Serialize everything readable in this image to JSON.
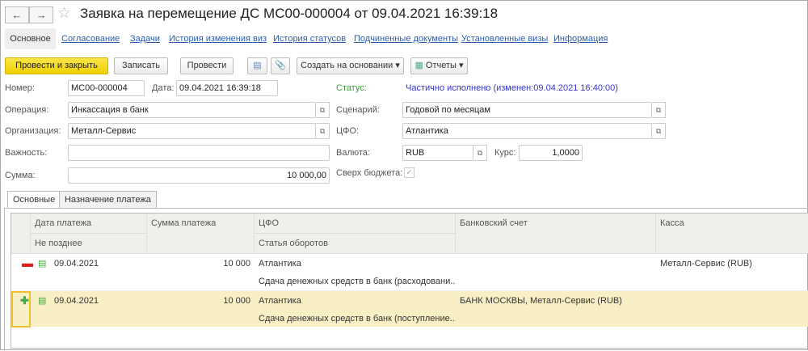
{
  "window": {
    "title": "Заявка на перемещение ДС МС00-000004 от 09.04.2021 16:39:18",
    "back": "←",
    "forward": "→",
    "star": "☆"
  },
  "tabs": [
    "Основное",
    "Согласование",
    "Задачи",
    "История изменения виз",
    "История статусов",
    "Подчиненные документы",
    "Установленные визы",
    "Информация"
  ],
  "toolbar": {
    "post_close": "Провести и закрыть",
    "save": "Записать",
    "post": "Провести",
    "create_based": "Создать на основании",
    "reports": "Отчеты",
    "dropdown": "▾"
  },
  "form": {
    "number_label": "Номер:",
    "number": "МС00-000004",
    "date_label": "Дата:",
    "date": "09.04.2021 16:39:18",
    "operation_label": "Операция:",
    "operation": "Инкассация в банк",
    "org_label": "Организация:",
    "org": "Металл-Сервис",
    "importance_label": "Важность:",
    "importance": "",
    "sum_label": "Сумма:",
    "sum": "10 000,00",
    "status_label": "Статус:",
    "status": "Частично исполнено (изменен:09.04.2021 16:40:00)",
    "scenario_label": "Сценарий:",
    "scenario": "Годовой по месяцам",
    "cfo_label": "ЦФО:",
    "cfo": "Атлантика",
    "currency_label": "Валюта:",
    "currency": "RUB",
    "rate_label": "Курс:",
    "rate": "1,0000",
    "over_budget_label": "Сверх бюджета:",
    "over_budget": true
  },
  "subtabs": [
    "Основные",
    "Назначение платежа"
  ],
  "table": {
    "headers": {
      "date": "Дата платежа",
      "not_later": "Не позднее",
      "sum": "Сумма платежа",
      "cfo": "ЦФО",
      "article": "Статья оборотов",
      "bank": "Банковский счет",
      "cash": "Касса"
    },
    "rows": [
      {
        "sign": "minus",
        "date": "09.04.2021",
        "sum": "10 000",
        "cfo": "Атлантика",
        "article": "Сдача денежных средств в банк (расходовани...",
        "bank": "",
        "cash": "Металл-Сервис (RUB)"
      },
      {
        "sign": "plus",
        "date": "09.04.2021",
        "sum": "10 000",
        "cfo": "Атлантика",
        "article": "Сдача денежных средств в банк (поступление...",
        "bank": "БАНК МОСКВЫ, Металл-Сервис (RUB)",
        "cash": ""
      }
    ]
  },
  "colors": {
    "accent_button": "#f5d800",
    "status_label": "#3a9a3a",
    "status_value": "#3333cc",
    "selected_row": "#f8efc5",
    "minus": "#d22",
    "plus": "#4a4"
  }
}
